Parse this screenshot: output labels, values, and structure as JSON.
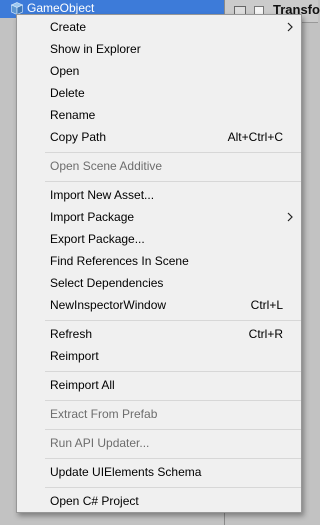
{
  "hierarchy": {
    "selected_item": "GameObject"
  },
  "inspector": {
    "title_fragment": "Transfo"
  },
  "context_menu": {
    "create": "Create",
    "show_in_explorer": "Show in Explorer",
    "open": "Open",
    "delete": "Delete",
    "rename": "Rename",
    "copy_path": "Copy Path",
    "copy_path_shortcut": "Alt+Ctrl+C",
    "open_scene_additive": "Open Scene Additive",
    "import_new_asset": "Import New Asset...",
    "import_package": "Import Package",
    "export_package": "Export Package...",
    "find_references": "Find References In Scene",
    "select_dependencies": "Select Dependencies",
    "new_inspector_window": "NewInspectorWindow",
    "new_inspector_window_shortcut": "Ctrl+L",
    "refresh": "Refresh",
    "refresh_shortcut": "Ctrl+R",
    "reimport": "Reimport",
    "reimport_all": "Reimport All",
    "extract_from_prefab": "Extract From Prefab",
    "run_api_updater": "Run API Updater...",
    "update_uielements_schema": "Update UIElements Schema",
    "open_csharp_project": "Open C# Project"
  },
  "icons": {
    "gameobject": "cube-icon",
    "submenu": "chevron-right-icon"
  },
  "colors": {
    "selection": "#3d7bd9",
    "menu_bg": "#f0f0f0",
    "disabled_text": "#6d6d6d"
  }
}
